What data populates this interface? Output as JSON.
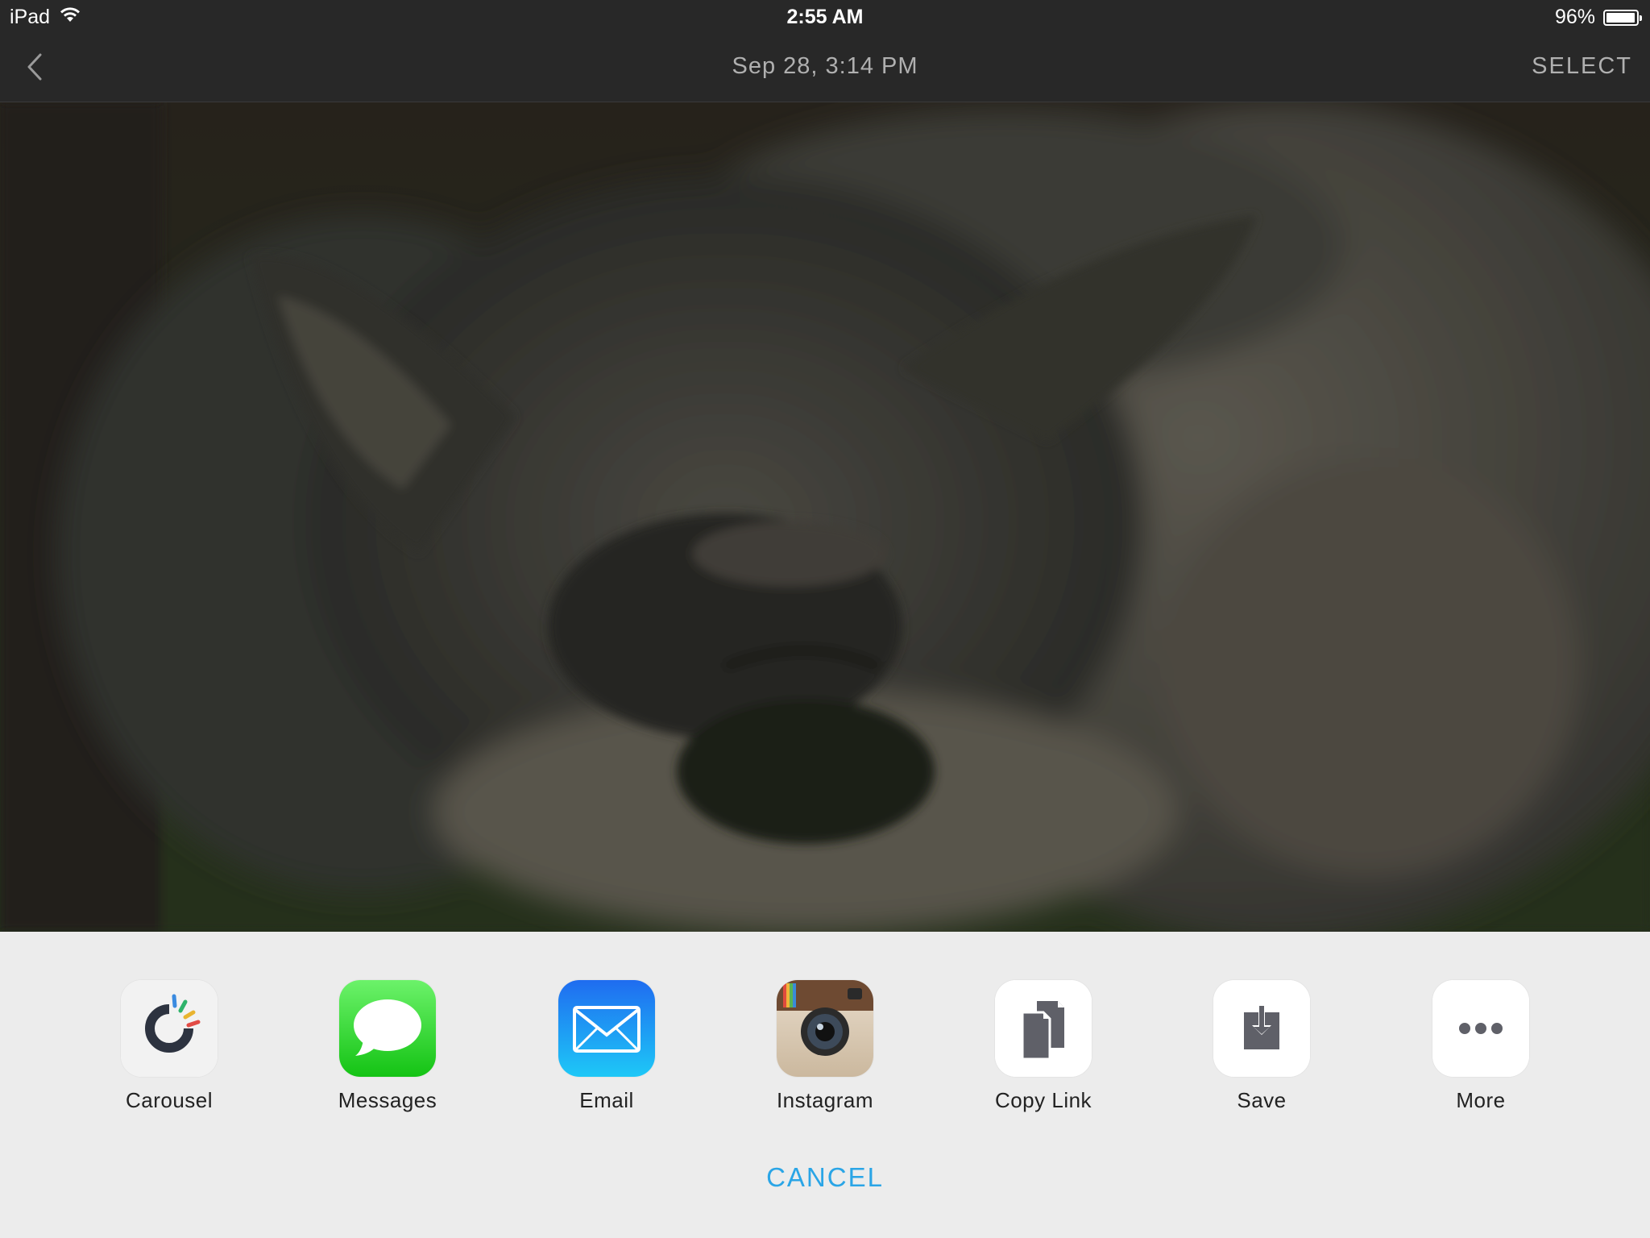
{
  "status_bar": {
    "device": "iPad",
    "time": "2:55 AM",
    "battery_percent": "96%",
    "battery_level": 0.96,
    "wifi_icon": "wifi-icon",
    "battery_icon": "battery-icon"
  },
  "nav": {
    "back_icon": "chevron-left-icon",
    "title": "Sep 28, 3:14 PM",
    "select_label": "SELECT"
  },
  "photo": {
    "colors": {
      "fur_dark": "#2f302c",
      "fur_light": "#6b685f",
      "grass": "#3b4a2e"
    }
  },
  "share": {
    "items": [
      {
        "label": "Carousel",
        "icon": "carousel-app-icon"
      },
      {
        "label": "Messages",
        "icon": "messages-app-icon"
      },
      {
        "label": "Email",
        "icon": "mail-app-icon"
      },
      {
        "label": "Instagram",
        "icon": "instagram-app-icon"
      },
      {
        "label": "Copy Link",
        "icon": "copy-link-icon"
      },
      {
        "label": "Save",
        "icon": "save-download-icon"
      },
      {
        "label": "More",
        "icon": "more-dots-icon"
      }
    ],
    "cancel_label": "CANCEL",
    "colors": {
      "accent": "#2aa5e6",
      "sheet_bg": "#ececec"
    }
  }
}
